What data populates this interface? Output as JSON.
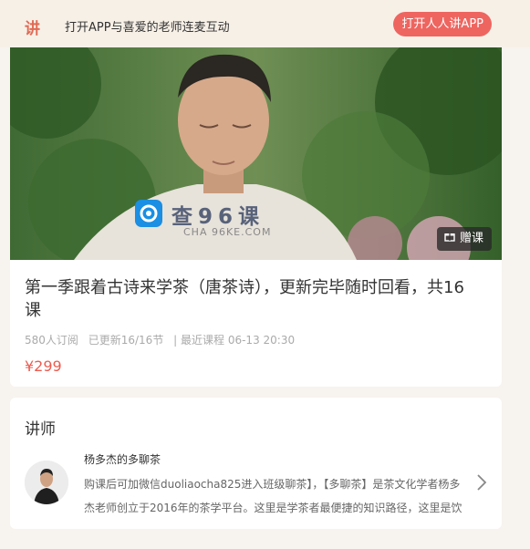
{
  "banner": {
    "logo": "讲",
    "message": "打开APP与喜爱的老师连麦互动",
    "open_app_label": "打开人人讲APP"
  },
  "course": {
    "gift_label": "赠课",
    "title": "第一季跟着古诗来学茶（唐茶诗），更新完毕随时回看，共16课",
    "subscribers": "580人订阅",
    "updated": "已更新16/16节",
    "recent": "| 最近课程 06-13 20:30",
    "price": "¥299"
  },
  "watermark": {
    "title": "查96课",
    "subtitle": "CHA 96KE.COM"
  },
  "teacher": {
    "section_title": "讲师",
    "name": "杨多杰的多聊茶",
    "description": "购课后可加微信duoliaocha825进入班级聊茶】，【多聊茶】是茶文化学者杨多杰老师创立于2016年的茶学平台。这里是学茶者最便捷的知识路径，这里是饮"
  },
  "colors": {
    "accent": "#ee6560",
    "price": "#ec5b4f",
    "banner_bg": "#f7f0e7"
  }
}
